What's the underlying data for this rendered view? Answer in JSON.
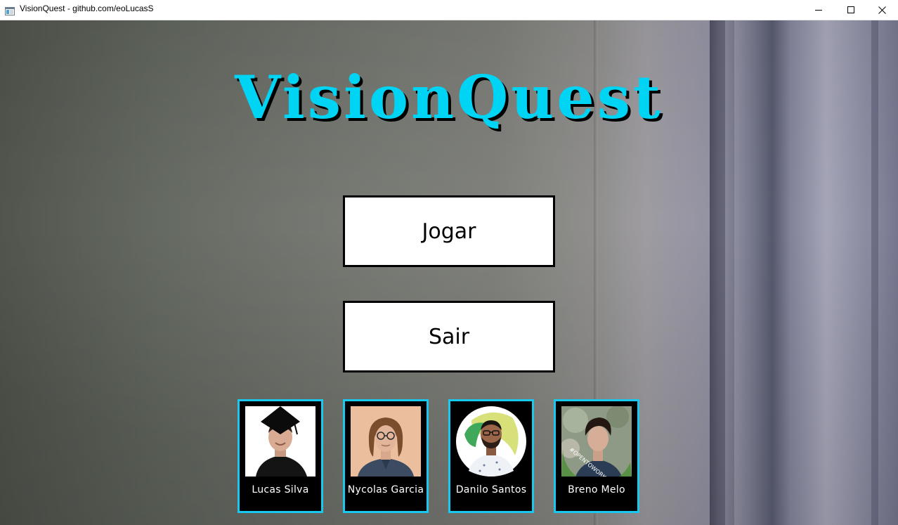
{
  "window": {
    "title": "VisionQuest - github.com/eoLucasS"
  },
  "game": {
    "title": "VisionQuest",
    "title_color": "#00d4f5"
  },
  "menu": {
    "play_label": "Jogar",
    "exit_label": "Sair"
  },
  "credits": [
    {
      "name": "Lucas Silva"
    },
    {
      "name": "Nycolas Garcia"
    },
    {
      "name": "Danilo Santos"
    },
    {
      "name": "Breno Melo",
      "badge": "#OPENTOWORK"
    }
  ],
  "colors": {
    "card_border": "#19c8ef",
    "card_background": "#000000",
    "button_background": "#ffffff"
  },
  "icons": {
    "app": "app-window-icon",
    "minimize": "minimize-icon",
    "maximize": "maximize-icon",
    "close": "close-icon"
  }
}
